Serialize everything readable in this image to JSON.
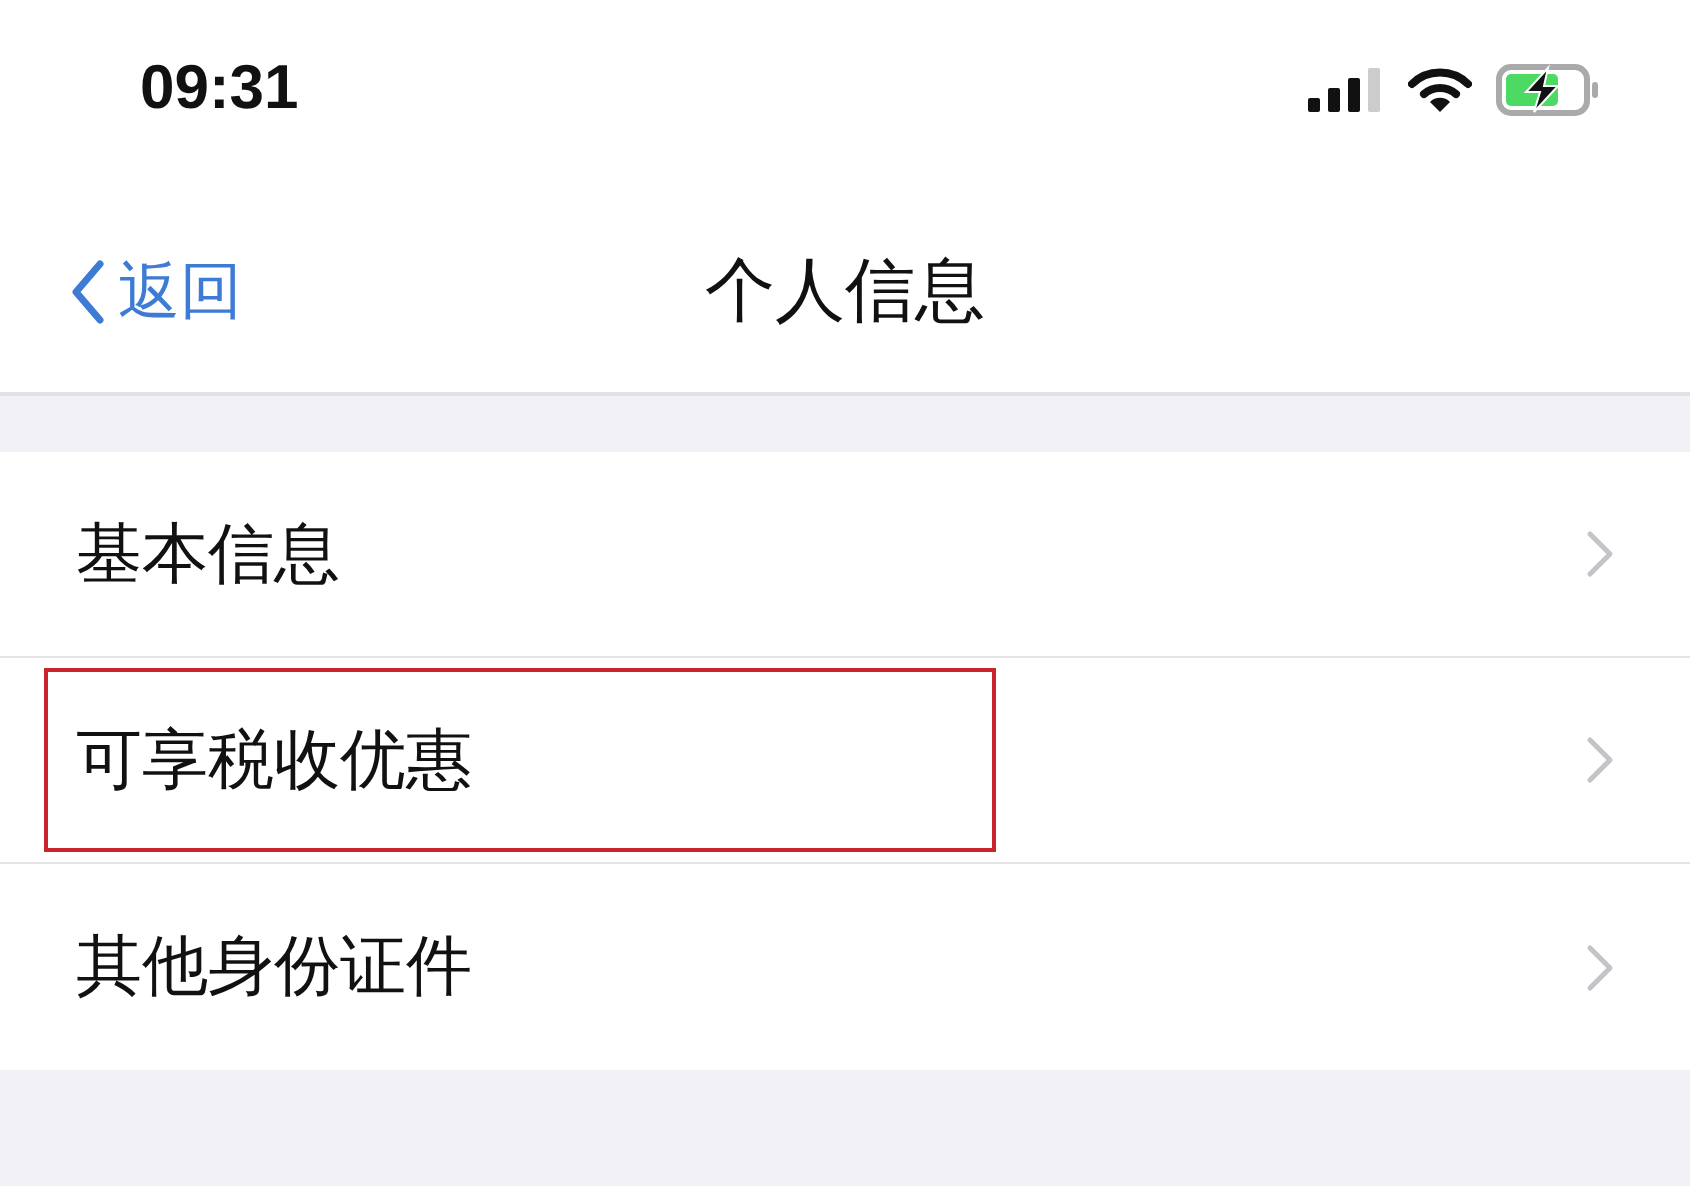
{
  "status_bar": {
    "time": "09:31",
    "battery_charging": true
  },
  "nav": {
    "back": "返回",
    "title": "个人信息"
  },
  "items": [
    {
      "label": "基本信息",
      "highlighted": false
    },
    {
      "label": "可享税收优惠",
      "highlighted": true
    },
    {
      "label": "其他身份证件",
      "highlighted": false
    }
  ]
}
